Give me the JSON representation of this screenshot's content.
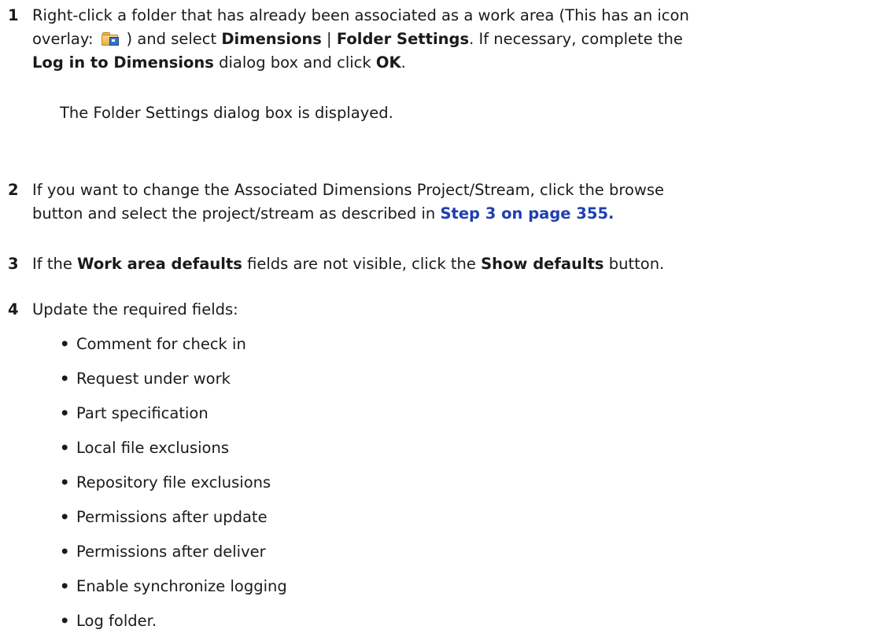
{
  "steps": [
    {
      "number": "1",
      "lines": {
        "l1_a": "Right-click a folder that has already been associated as a work area (This has an icon",
        "l2_a": "overlay:",
        "l2_b": ") and select ",
        "l2_c": "Dimensions",
        "l2_d": " | ",
        "l2_e": "Folder Settings",
        "l2_f": ". If necessary, complete the",
        "l3_a": "Log in to Dimensions",
        "l3_b": " dialog box and click ",
        "l3_c": "OK",
        "l3_d": "."
      },
      "result": "The Folder Settings dialog box is displayed.",
      "icon": "work-area-folder-icon"
    },
    {
      "number": "2",
      "lines": {
        "l1_a": "If you want to change the Associated Dimensions Project/Stream, click the browse",
        "l2_a": "button and select the project/stream as described in ",
        "l2_link": "Step 3 on page 355."
      }
    },
    {
      "number": "3",
      "lines": {
        "l1_a": "If the ",
        "l1_b": "Work area defaults",
        "l1_c": " fields are not visible, click the ",
        "l1_d": "Show defaults",
        "l1_e": " button."
      }
    },
    {
      "number": "4",
      "lines": {
        "l1_a": "Update the required fields:"
      },
      "bullets": [
        "Comment for check in",
        "Request under work",
        "Part specification",
        "Local file exclusions",
        "Repository file exclusions",
        "Permissions after update",
        "Permissions after deliver",
        "Enable synchronize logging",
        "Log folder."
      ]
    }
  ],
  "colors": {
    "text": "#1a1a1a",
    "link": "#1f3fb0"
  },
  "bullet_symbol": "•"
}
